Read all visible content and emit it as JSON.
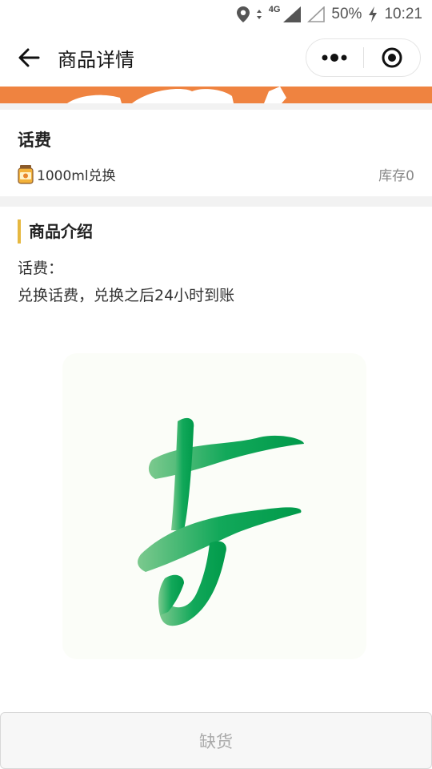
{
  "status_bar": {
    "network": "4G",
    "battery": "50%",
    "time": "10:21"
  },
  "nav": {
    "title": "商品详情"
  },
  "colors": {
    "banner_orange": "#ef8340",
    "intro_accent": "#e6b840",
    "logo_green": "#1aa75a"
  },
  "product": {
    "name": "话费",
    "price": "1000ml兑换",
    "stock": "库存0"
  },
  "intro": {
    "heading": "商品介绍",
    "line1": "话费：",
    "line2": "兑换话费，兑换之后24小时到账"
  },
  "action": {
    "button_label": "缺货"
  },
  "icons": [
    "location-icon",
    "wifi-arrows-icon",
    "signal-icon",
    "signal-empty-icon",
    "charging-icon",
    "back-arrow-icon",
    "more-dots-icon",
    "close-target-icon",
    "jar-icon",
    "logo-glyph"
  ]
}
